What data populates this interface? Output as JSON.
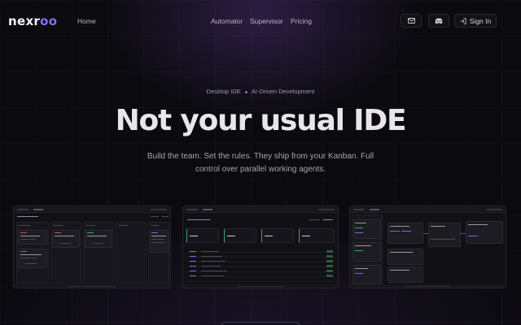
{
  "nav": {
    "logo_main": "nexr",
    "logo_accent": "oo",
    "home": "Home",
    "automator": "Automator",
    "supervisor": "Supervisor",
    "pricing": "Pricing",
    "mail_icon": "mail-icon",
    "discord_icon": "discord-icon",
    "signin_icon": "sign-in-icon",
    "signin": "Sign In"
  },
  "hero": {
    "badge_left": "Desktop IDE",
    "badge_right": "AI-Driven Development",
    "title": "Not your usual IDE",
    "subtitle": "Build the team. Set the rules. They ship from your Kanban. Full control over parallel working agents."
  },
  "colors": {
    "background": "#0b0a0f",
    "accent": "#8b6cf0",
    "success": "#3aa870",
    "danger": "#c0506a"
  }
}
